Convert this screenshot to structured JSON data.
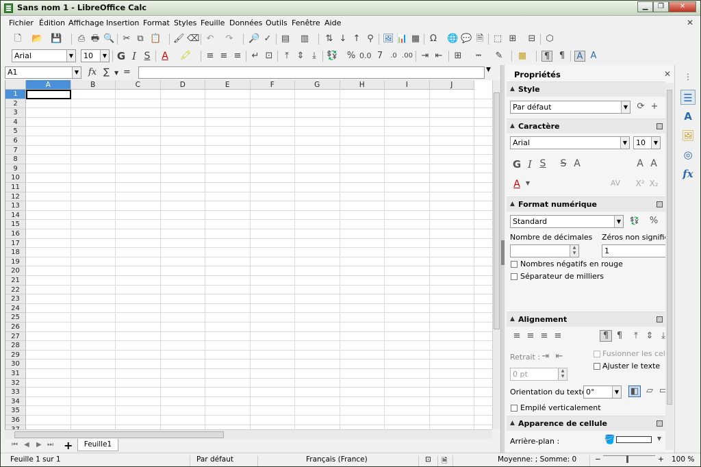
{
  "window": {
    "title": "Sans nom 1 - LibreOffice Calc",
    "min": "▁",
    "max": "❐",
    "close": "✕"
  },
  "menu": [
    "Fichier",
    "Édition",
    "Affichage",
    "Insertion",
    "Format",
    "Styles",
    "Feuille",
    "Données",
    "Outils",
    "Fenêtre",
    "Aide"
  ],
  "toolbar": {
    "font_name": "Arial",
    "font_size": "10"
  },
  "formula_bar": {
    "cell_ref": "A1",
    "fx": "fx",
    "sum": "∑",
    "eq": "=",
    "content": ""
  },
  "grid": {
    "columns": [
      "A",
      "B",
      "C",
      "D",
      "E",
      "F",
      "G",
      "H",
      "I",
      "J"
    ],
    "rows": [
      "1",
      "2",
      "3",
      "4",
      "5",
      "6",
      "7",
      "8",
      "9",
      "10",
      "11",
      "12",
      "13",
      "14",
      "15",
      "16",
      "17",
      "18",
      "19",
      "20",
      "21",
      "22",
      "23",
      "24",
      "25",
      "26",
      "27",
      "28",
      "29",
      "30",
      "31",
      "32",
      "33",
      "34",
      "35",
      "36",
      "37"
    ],
    "selected_col": "A",
    "selected_row": "1"
  },
  "sheet_tabs": {
    "add": "+",
    "active": "Feuille1"
  },
  "status": {
    "sheet": "Feuille 1 sur 1",
    "page_style": "Par défaut",
    "language": "Français (France)",
    "summary": "Moyenne: ; Somme: 0",
    "zoom": "100 %",
    "zoom_minus": "−",
    "zoom_plus": "+"
  },
  "sidebar": {
    "title": "Propriétés",
    "style": {
      "header": "Style",
      "value": "Par défaut"
    },
    "character": {
      "header": "Caractère",
      "font": "Arial",
      "size": "10"
    },
    "number_format": {
      "header": "Format numérique",
      "value": "Standard",
      "decimals_label": "Nombre de décimales",
      "zeros_label": "Zéros non significatifs",
      "zeros_value": "1",
      "negative_red": "Nombres négatifs en rouge",
      "thousands_sep": "Séparateur de milliers",
      "percent": "%"
    },
    "alignment": {
      "header": "Alignement",
      "indent_label": "Retrait :",
      "indent_value": "0 pt",
      "merge_cells": "Fusionner les cellules",
      "wrap_text": "Ajuster le texte",
      "orientation_label": "Orientation du texte :",
      "orientation_value": "0°",
      "stacked": "Empilé verticalement"
    },
    "appearance": {
      "header": "Apparence de cellule",
      "background_label": "Arrière-plan :"
    }
  },
  "colors": {
    "selection": "#4a90d9",
    "deck_icon": "#2a6ab0"
  }
}
